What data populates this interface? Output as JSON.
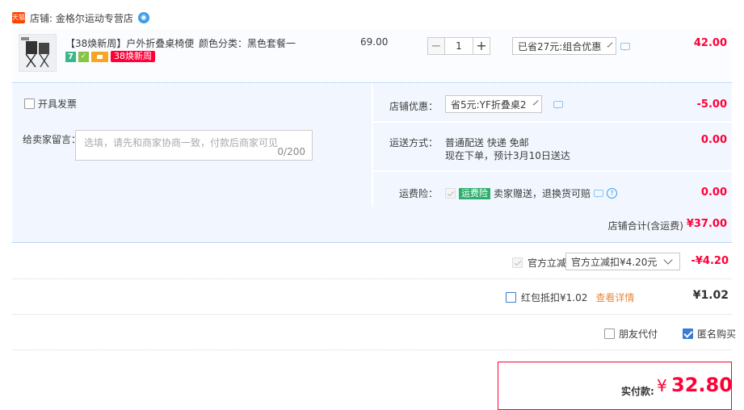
{
  "shop": {
    "badge": "天猫",
    "label": "店铺: 金格尔运动专营店",
    "chat_icon": "wangwang-icon"
  },
  "item": {
    "title": "【38焕新周】户外折叠桌椅便...",
    "tags": {
      "seven": "7",
      "green": "✓",
      "promo": "38焕新周"
    },
    "sku": "颜色分类：黑色套餐一",
    "unit_price": "69.00",
    "quantity": "1",
    "minus": "−",
    "plus": "+",
    "promo_select": "已省27元:组合优惠",
    "subtotal": "42.00"
  },
  "order": {
    "invoice_label": "开具发票",
    "message_label": "给卖家留言：",
    "message_placeholder": "选填，请先和商家协商一致，付款后商家可见",
    "message_count": "0/200",
    "shop_coupon_label": "店铺优惠：",
    "shop_coupon_select": "省5元:YF折叠桌2",
    "shop_coupon_value": "-5.00",
    "shipping_label": "运送方式：",
    "shipping_method": "普通配送 快递 免邮",
    "shipping_eta": "现在下单，预计3月10日送达",
    "shipping_value": "0.00",
    "insurance_label": "运费险：",
    "insurance_tag": "运费险",
    "insurance_text": "卖家赠送，退换货可赔",
    "insurance_value": "0.00",
    "shop_total_label": "店铺合计(含运费)",
    "shop_total_value": "¥37.00"
  },
  "official_discount": {
    "label": "官方立减",
    "select": "官方立减扣¥4.20元",
    "value": "-¥4.20"
  },
  "red_packet": {
    "label": "红包抵扣¥1.02",
    "link": "查看详情",
    "value": "¥1.02"
  },
  "options": {
    "friend_pay": "朋友代付",
    "anonymous": "匿名购买"
  },
  "final": {
    "label": "实付款:",
    "currency": "¥",
    "amount": "32.80"
  }
}
